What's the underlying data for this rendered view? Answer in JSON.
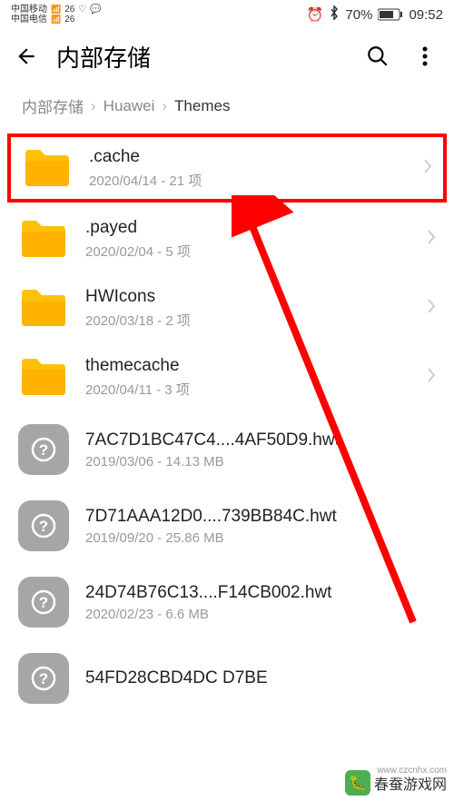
{
  "status_bar": {
    "carrier1": "中国移动",
    "carrier2": "中国电信",
    "net_label": "26",
    "battery_pct": "70%",
    "time": "09:52"
  },
  "header": {
    "title": "内部存储"
  },
  "breadcrumb": {
    "items": [
      "内部存储",
      "Huawei",
      "Themes"
    ]
  },
  "files": [
    {
      "name": ".cache",
      "meta": "2020/04/14 - 21 项",
      "type": "folder",
      "highlighted": true
    },
    {
      "name": ".payed",
      "meta": "2020/02/04 - 5 项",
      "type": "folder",
      "highlighted": false
    },
    {
      "name": "HWIcons",
      "meta": "2020/03/18 - 2 项",
      "type": "folder",
      "highlighted": false
    },
    {
      "name": "themecache",
      "meta": "2020/04/11 - 3 项",
      "type": "folder",
      "highlighted": false
    },
    {
      "name": "7AC7D1BC47C4....4AF50D9.hwt",
      "meta": "2019/03/06 - 14.13 MB",
      "type": "file",
      "highlighted": false
    },
    {
      "name": "7D71AAA12D0....739BB84C.hwt",
      "meta": "2019/09/20 - 25.86 MB",
      "type": "file",
      "highlighted": false
    },
    {
      "name": "24D74B76C13....F14CB002.hwt",
      "meta": "2020/02/23 - 6.6 MB",
      "type": "file",
      "highlighted": false
    },
    {
      "name": "54FD28CBD4DC   D7BE",
      "meta": "",
      "type": "file",
      "highlighted": false
    }
  ],
  "watermark": {
    "text": "春蚕游戏网",
    "url": "www.czcnhx.com"
  }
}
